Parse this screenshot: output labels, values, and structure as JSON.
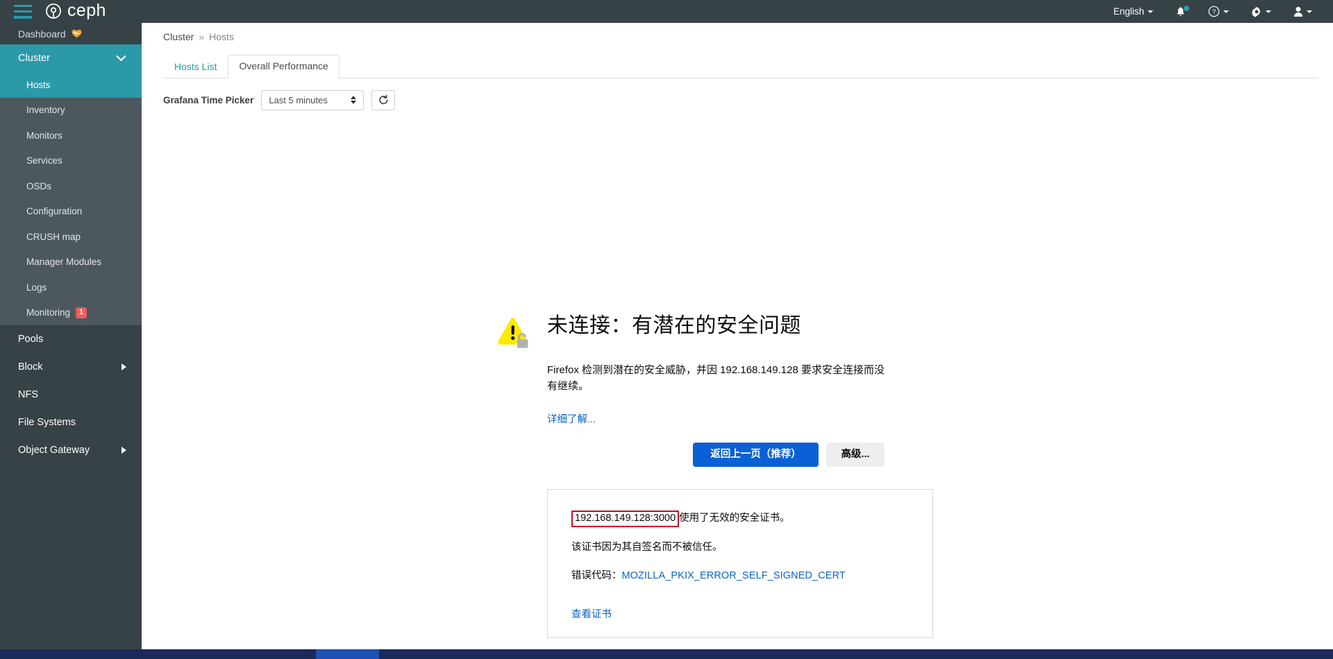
{
  "header": {
    "brand_text": "ceph",
    "menu_icon": "hamburger-menu-icon",
    "language_label": "English",
    "notifications_icon": "bell-icon",
    "help_icon": "help-circle-icon",
    "settings_icon": "gear-icon",
    "user_icon": "user-icon"
  },
  "sidebar": {
    "dashboard": {
      "label": "Dashboard",
      "health_icon": "heartbeat-icon"
    },
    "cluster": {
      "label": "Cluster",
      "expanded": true,
      "items": [
        {
          "label": "Hosts",
          "active": true
        },
        {
          "label": "Inventory",
          "active": false
        },
        {
          "label": "Monitors",
          "active": false
        },
        {
          "label": "Services",
          "active": false
        },
        {
          "label": "OSDs",
          "active": false
        },
        {
          "label": "Configuration",
          "active": false
        },
        {
          "label": "CRUSH map",
          "active": false
        },
        {
          "label": "Manager Modules",
          "active": false
        },
        {
          "label": "Logs",
          "active": false
        },
        {
          "label": "Monitoring",
          "active": false,
          "badge": "1"
        }
      ]
    },
    "items": [
      {
        "label": "Pools",
        "has_arrow": false
      },
      {
        "label": "Block",
        "has_arrow": true
      },
      {
        "label": "NFS",
        "has_arrow": false
      },
      {
        "label": "File Systems",
        "has_arrow": false
      },
      {
        "label": "Object Gateway",
        "has_arrow": true
      }
    ]
  },
  "breadcrumb": {
    "root": "Cluster",
    "separator": "»",
    "current": "Hosts"
  },
  "tabs": [
    {
      "label": "Hosts List",
      "active": false
    },
    {
      "label": "Overall Performance",
      "active": true
    }
  ],
  "toolbar": {
    "time_picker_label": "Grafana Time Picker",
    "time_picker_value": "Last 5 minutes",
    "refresh_icon": "refresh-icon"
  },
  "error_page": {
    "warning_icon": "warning-triangle-lock-icon",
    "title": "未连接：有潜在的安全问题",
    "description": "Firefox 检测到潜在的安全威胁，并因 192.168.149.128 要求安全连接而没有继续。",
    "learn_more": "详细了解...",
    "back_button": "返回上一页（推荐）",
    "advanced_button": "高级...",
    "panel": {
      "host": "192.168.149.128:3000",
      "host_suffix": "使用了无效的安全证书。",
      "reason": "该证书因为其自签名而不被信任。",
      "error_code_label": "错误代码：",
      "error_code": "MOZILLA_PKIX_ERROR_SELF_SIGNED_CERT",
      "view_certificate": "查看证书"
    }
  },
  "colors": {
    "header_bg": "#374246",
    "accent_teal": "#2b99a8",
    "submenu_bg": "#4c585e",
    "badge_red": "#ef5b5b",
    "link_blue": "#0a63c9",
    "primary_button": "#0a60d6",
    "highlight_border": "#d70022",
    "taskbar_bg": "#1b2a58",
    "taskbar_active": "#1f50b5"
  }
}
